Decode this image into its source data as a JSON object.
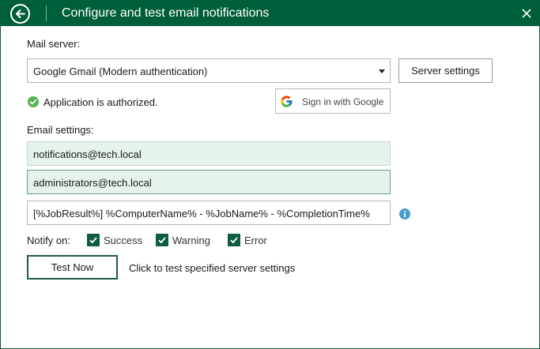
{
  "window": {
    "title": "Configure and test email notifications"
  },
  "icons": {
    "back": "back-arrow-circle-icon",
    "close": "close-icon",
    "status": "check-circle-icon",
    "google": "google-g-icon",
    "info": "info-icon",
    "checkbox": "checkmark-icon"
  },
  "colors": {
    "titlebar": "#005f3b",
    "accent": "#0f5c40",
    "field_fill": "#e6f3ea",
    "status_ok": "#56b24f",
    "info": "#4a9bd1"
  },
  "mail_server": {
    "label": "Mail server:",
    "selected": "Google Gmail (Modern authentication)",
    "server_settings_label": "Server settings"
  },
  "auth": {
    "status_text": "Application is authorized.",
    "sign_in_label": "Sign in with Google"
  },
  "email_settings": {
    "label": "Email settings:",
    "from": "notifications@tech.local",
    "to": "administrators@tech.local",
    "subject": "[%JobResult%] %ComputerName% - %JobName% - %CompletionTime%"
  },
  "notify": {
    "label": "Notify on:",
    "options": [
      {
        "label": "Success",
        "checked": true
      },
      {
        "label": "Warning",
        "checked": true
      },
      {
        "label": "Error",
        "checked": true
      }
    ]
  },
  "test": {
    "button_label": "Test Now",
    "hint": "Click to test specified server settings"
  }
}
